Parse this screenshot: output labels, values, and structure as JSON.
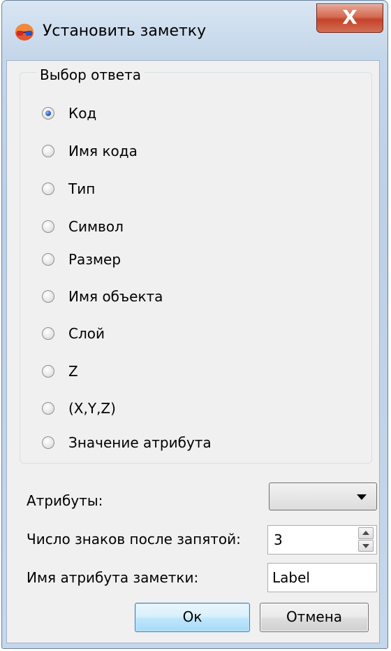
{
  "window": {
    "title": "Установить заметку",
    "close_label": "X"
  },
  "answer_group": {
    "legend": "Выбор ответа",
    "selected_index": 0,
    "options": [
      {
        "label": "Код",
        "checked": true
      },
      {
        "label": "Имя кода",
        "checked": false
      },
      {
        "label": "Тип",
        "checked": false
      },
      {
        "label": "Символ",
        "checked": false
      },
      {
        "label": "Размер",
        "checked": false
      },
      {
        "label": "Имя объекта",
        "checked": false
      },
      {
        "label": "Слой",
        "checked": false
      },
      {
        "label": "Z",
        "checked": false
      },
      {
        "label": "(X,Y,Z)",
        "checked": false
      },
      {
        "label": "Значение атрибута",
        "checked": false
      }
    ]
  },
  "fields": {
    "attributes_label": "Атрибуты:",
    "attributes_value": "",
    "decimals_label": "Число знаков после запятой:",
    "decimals_value": "3",
    "attr_name_label": "Имя атрибута заметки:",
    "attr_name_value": "Label"
  },
  "buttons": {
    "ok": "Ок",
    "cancel": "Отмена"
  },
  "colors": {
    "close_button": "#c4432a",
    "radio_selected": "#2a5dc0",
    "ok_border": "#3c7fb1"
  }
}
